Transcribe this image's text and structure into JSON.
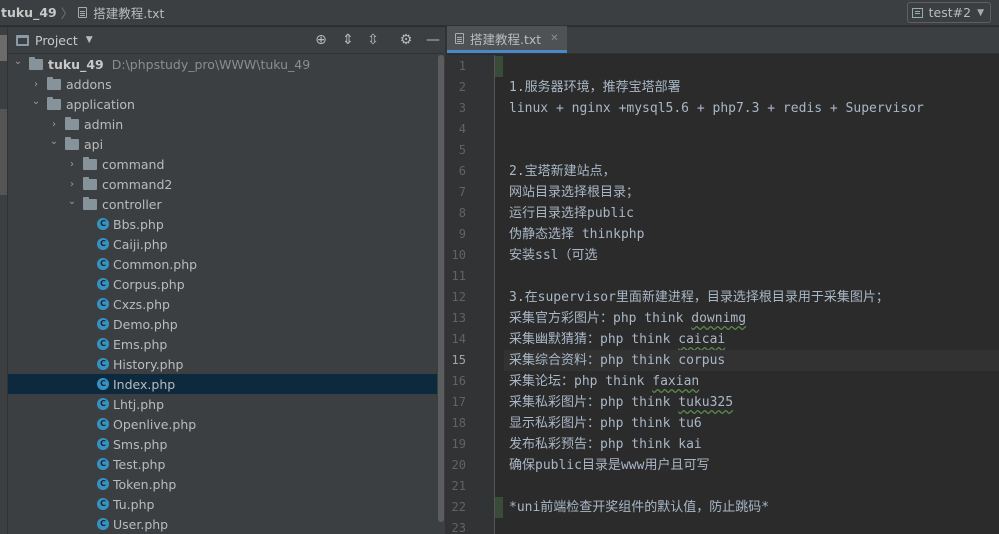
{
  "navbar": {
    "project_name": "tuku_49",
    "separator": "〉",
    "file_name": "搭建教程.txt",
    "run_config": "test#2"
  },
  "project_panel": {
    "title": "Project",
    "tools": [
      "locate-icon",
      "expand-all-icon",
      "collapse-all-icon",
      "gear-icon",
      "minimize-icon"
    ]
  },
  "tree": [
    {
      "name": "tuku_49",
      "path": "D:\\phpstudy_pro\\WWW\\tuku_49",
      "type": "folder",
      "depth": 0,
      "expanded": true,
      "bold": true
    },
    {
      "name": "addons",
      "type": "folder",
      "depth": 1,
      "expanded": false
    },
    {
      "name": "application",
      "type": "folder",
      "depth": 1,
      "expanded": true
    },
    {
      "name": "admin",
      "type": "folder",
      "depth": 2,
      "expanded": false
    },
    {
      "name": "api",
      "type": "folder",
      "depth": 2,
      "expanded": true
    },
    {
      "name": "command",
      "type": "folder",
      "depth": 3,
      "expanded": false
    },
    {
      "name": "command2",
      "type": "folder",
      "depth": 3,
      "expanded": false
    },
    {
      "name": "controller",
      "type": "folder",
      "depth": 3,
      "expanded": true
    },
    {
      "name": "Bbs.php",
      "type": "class",
      "depth": 4
    },
    {
      "name": "Caiji.php",
      "type": "class",
      "depth": 4
    },
    {
      "name": "Common.php",
      "type": "class",
      "depth": 4
    },
    {
      "name": "Corpus.php",
      "type": "class",
      "depth": 4
    },
    {
      "name": "Cxzs.php",
      "type": "class",
      "depth": 4
    },
    {
      "name": "Demo.php",
      "type": "class",
      "depth": 4
    },
    {
      "name": "Ems.php",
      "type": "class",
      "depth": 4
    },
    {
      "name": "History.php",
      "type": "class",
      "depth": 4
    },
    {
      "name": "Index.php",
      "type": "class",
      "depth": 4,
      "selected": true
    },
    {
      "name": "Lhtj.php",
      "type": "class",
      "depth": 4
    },
    {
      "name": "Openlive.php",
      "type": "class",
      "depth": 4
    },
    {
      "name": "Sms.php",
      "type": "class",
      "depth": 4
    },
    {
      "name": "Test.php",
      "type": "class",
      "depth": 4
    },
    {
      "name": "Token.php",
      "type": "class",
      "depth": 4
    },
    {
      "name": "Tu.php",
      "type": "class",
      "depth": 4
    },
    {
      "name": "User.php",
      "type": "class",
      "depth": 4
    }
  ],
  "editor": {
    "tab_label": "搭建教程.txt",
    "current_line": 15,
    "lines": [
      "",
      "1.服务器环境，推荐宝塔部署",
      "linux + nginx +mysql5.6 + php7.3 + redis + Supervisor",
      "",
      "",
      "2.宝塔新建站点，",
      "网站目录选择根目录；",
      "运行目录选择public",
      "伪静态选择 thinkphp",
      "安装ssl（可选",
      "",
      "3.在supervisor里面新建进程，目录选择根目录用于采集图片；",
      "采集官方彩图片：php think downimg",
      "采集幽默猜猜：php think caicai",
      "采集综合资料：php think corpus",
      "采集论坛：php think faxian",
      "采集私彩图片：php think tuku325",
      "显示私彩图片：php think tu6",
      "发布私彩预告：php think kai",
      "确保public目录是www用户且可写",
      "",
      "*uni前端检查开奖组件的默认值，防止跳码*",
      ""
    ],
    "typo_words": [
      "downimg",
      "caicai",
      "faxian",
      "tuku325"
    ]
  }
}
